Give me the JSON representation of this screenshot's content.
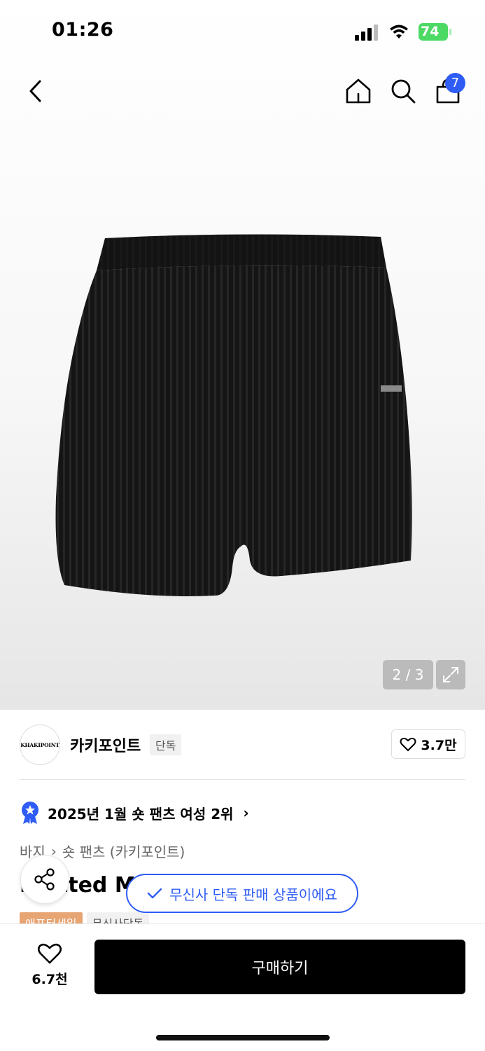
{
  "status_bar": {
    "time": "01:26",
    "battery": "74"
  },
  "header": {
    "cart_count": "7"
  },
  "gallery": {
    "counter": "2 / 3"
  },
  "brand": {
    "logo_text": "KHAKIPOINT",
    "name": "카키포인트",
    "tag": "단독",
    "likes": "3.7만"
  },
  "ranking": {
    "text": "2025년 1월 숏 팬츠 여성 2위"
  },
  "breadcrumb": {
    "items": [
      "바지",
      "숏 팬츠 (카키포인트)"
    ]
  },
  "product": {
    "title_visible": "Knitted Mini",
    "tags": [
      "애프터세일",
      "무신사단독"
    ]
  },
  "toast": {
    "text": "무신사 단독 판매 상품이에요"
  },
  "bottom_bar": {
    "wish_count": "6.7천",
    "buy_label": "구매하기"
  },
  "colors": {
    "accent_blue": "#2f5cf5",
    "sale_tag": "#e7a574",
    "battery_green": "#4cd964"
  }
}
